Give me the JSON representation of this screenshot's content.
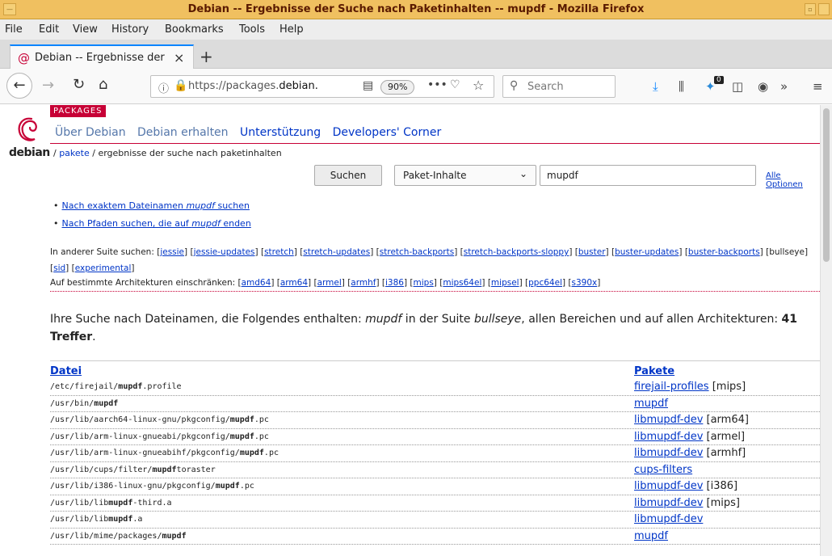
{
  "window": {
    "title": "Debian -- Ergebnisse der Suche nach Paketinhalten -- mupdf - Mozilla Firefox"
  },
  "menubar": [
    "File",
    "Edit",
    "View",
    "History",
    "Bookmarks",
    "Tools",
    "Help"
  ],
  "tab": {
    "title": "Debian -- Ergebnisse der",
    "close": "×",
    "new_tab": "+"
  },
  "navbar": {
    "url_prefix": "https://packages.",
    "url_domain": "debian.",
    "zoom": "90%",
    "search_placeholder": "Search",
    "notification_count": "0"
  },
  "site": {
    "badge": "PACKAGES",
    "logo_text": "debian",
    "nav": [
      {
        "label": "Über Debian",
        "style": "muted"
      },
      {
        "label": "Debian erhalten",
        "style": "muted"
      },
      {
        "label": "Unterstützung",
        "style": "strong"
      },
      {
        "label": "Developers' Corner",
        "style": "strong"
      }
    ],
    "breadcrumb": {
      "sep1": "/ ",
      "link": "pakete",
      "rest": " / ergebnisse der suche nach paketinhalten"
    }
  },
  "search": {
    "button": "Suchen",
    "mode": "Paket-Inhalte",
    "query": "mupdf",
    "all_options": "Alle Optionen"
  },
  "hints": [
    {
      "before": "Nach exaktem Dateinamen ",
      "em": "mupdf",
      "after": " suchen"
    },
    {
      "before": "Nach Pfaden suchen, die auf ",
      "em": "mupdf",
      "after": " enden"
    }
  ],
  "suites": {
    "label": "In anderer Suite suchen: ",
    "items": [
      "jessie",
      "jessie-updates",
      "stretch",
      "stretch-updates",
      "stretch-backports",
      "stretch-backports-sloppy",
      "buster",
      "buster-updates",
      "buster-backports",
      "bullseye",
      "sid",
      "experimental"
    ],
    "current": "bullseye"
  },
  "archs": {
    "label": "Auf bestimmte Architekturen einschränken: ",
    "items": [
      "amd64",
      "arm64",
      "armel",
      "armhf",
      "i386",
      "mips",
      "mips64el",
      "mipsel",
      "ppc64el",
      "s390x"
    ]
  },
  "result": {
    "t1": "Ihre Suche nach Dateinamen, die Folgendes enthalten: ",
    "q": "mupdf",
    "t2": " in der Suite ",
    "suite": "bullseye",
    "t3": ", allen Bereichen und auf allen Architekturen: ",
    "count": "41 Treffer",
    "t4": "."
  },
  "table": {
    "col_file": "Datei",
    "col_pkg": "Pakete",
    "rows": [
      {
        "pre": "/etc/firejail/",
        "hit": "mupdf",
        "post": ".profile",
        "pkg": "firejail-profiles",
        "arch": " [mips]"
      },
      {
        "pre": "/usr/bin/",
        "hit": "mupdf",
        "post": "",
        "pkg": "mupdf",
        "arch": ""
      },
      {
        "pre": "/usr/lib/aarch64-linux-gnu/pkgconfig/",
        "hit": "mupdf",
        "post": ".pc",
        "pkg": "libmupdf-dev",
        "arch": " [arm64]"
      },
      {
        "pre": "/usr/lib/arm-linux-gnueabi/pkgconfig/",
        "hit": "mupdf",
        "post": ".pc",
        "pkg": "libmupdf-dev",
        "arch": " [armel]"
      },
      {
        "pre": "/usr/lib/arm-linux-gnueabihf/pkgconfig/",
        "hit": "mupdf",
        "post": ".pc",
        "pkg": "libmupdf-dev",
        "arch": " [armhf]"
      },
      {
        "pre": "/usr/lib/cups/filter/",
        "hit": "mupdf",
        "post": "toraster",
        "pkg": "cups-filters",
        "arch": ""
      },
      {
        "pre": "/usr/lib/i386-linux-gnu/pkgconfig/",
        "hit": "mupdf",
        "post": ".pc",
        "pkg": "libmupdf-dev",
        "arch": " [i386]"
      },
      {
        "pre": "/usr/lib/lib",
        "hit": "mupdf",
        "post": "-third.a",
        "pkg": "libmupdf-dev",
        "arch": " [mips]"
      },
      {
        "pre": "/usr/lib/lib",
        "hit": "mupdf",
        "post": ".a",
        "pkg": "libmupdf-dev",
        "arch": ""
      },
      {
        "pre": "/usr/lib/mime/packages/",
        "hit": "mupdf",
        "post": "",
        "pkg": "mupdf",
        "arch": ""
      }
    ]
  }
}
